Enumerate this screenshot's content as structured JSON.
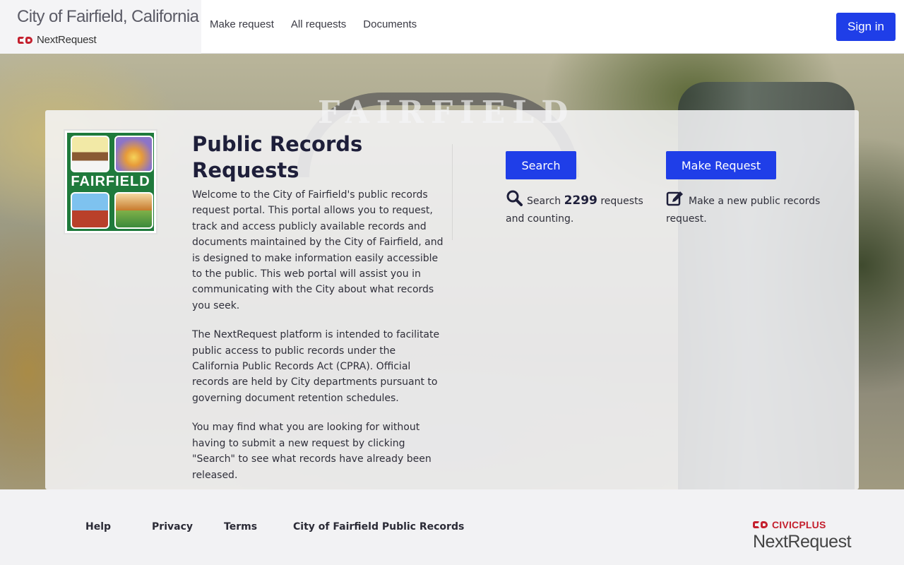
{
  "header": {
    "city_title": "City of Fairfield, California",
    "brand_name": "NextRequest",
    "nav": [
      "Make request",
      "All requests",
      "Documents"
    ],
    "signin_label": "Sign in"
  },
  "hero": {
    "arch_text": "FAIRFIELD",
    "seal_word": "FAIRFIELD",
    "title": "Public Records Requests",
    "paragraphs": [
      "Welcome to the City of Fairfield's public records request portal. This portal allows you to request, track and access publicly available records and documents maintained by the City of Fairfield, and is designed to make information easily accessible to the public. This web portal will assist you in communicating with the City about what records you seek.",
      "The NextRequest platform is intended to facilitate public access to public records under the California Public Records Act (CPRA). Official records are held by City departments pursuant to governing document retention schedules.",
      "You may find what you are looking for without having to submit a new request by clicking \"Search\" to see what records have already been released."
    ],
    "search": {
      "button_label": "Search",
      "desc_prefix": "Search",
      "count": "2299",
      "desc_suffix": "requests and counting."
    },
    "make": {
      "button_label": "Make Request",
      "desc": "Make a new public records request."
    }
  },
  "footer": {
    "links": [
      "Help",
      "Privacy",
      "Terms",
      "City of Fairfield Public Records"
    ],
    "civic_label": "CIVICPLUS",
    "nr_label": "NextRequest"
  },
  "colors": {
    "primary": "#1f3ee8",
    "civic_red": "#c4202e",
    "heading": "#1e1f3a"
  }
}
